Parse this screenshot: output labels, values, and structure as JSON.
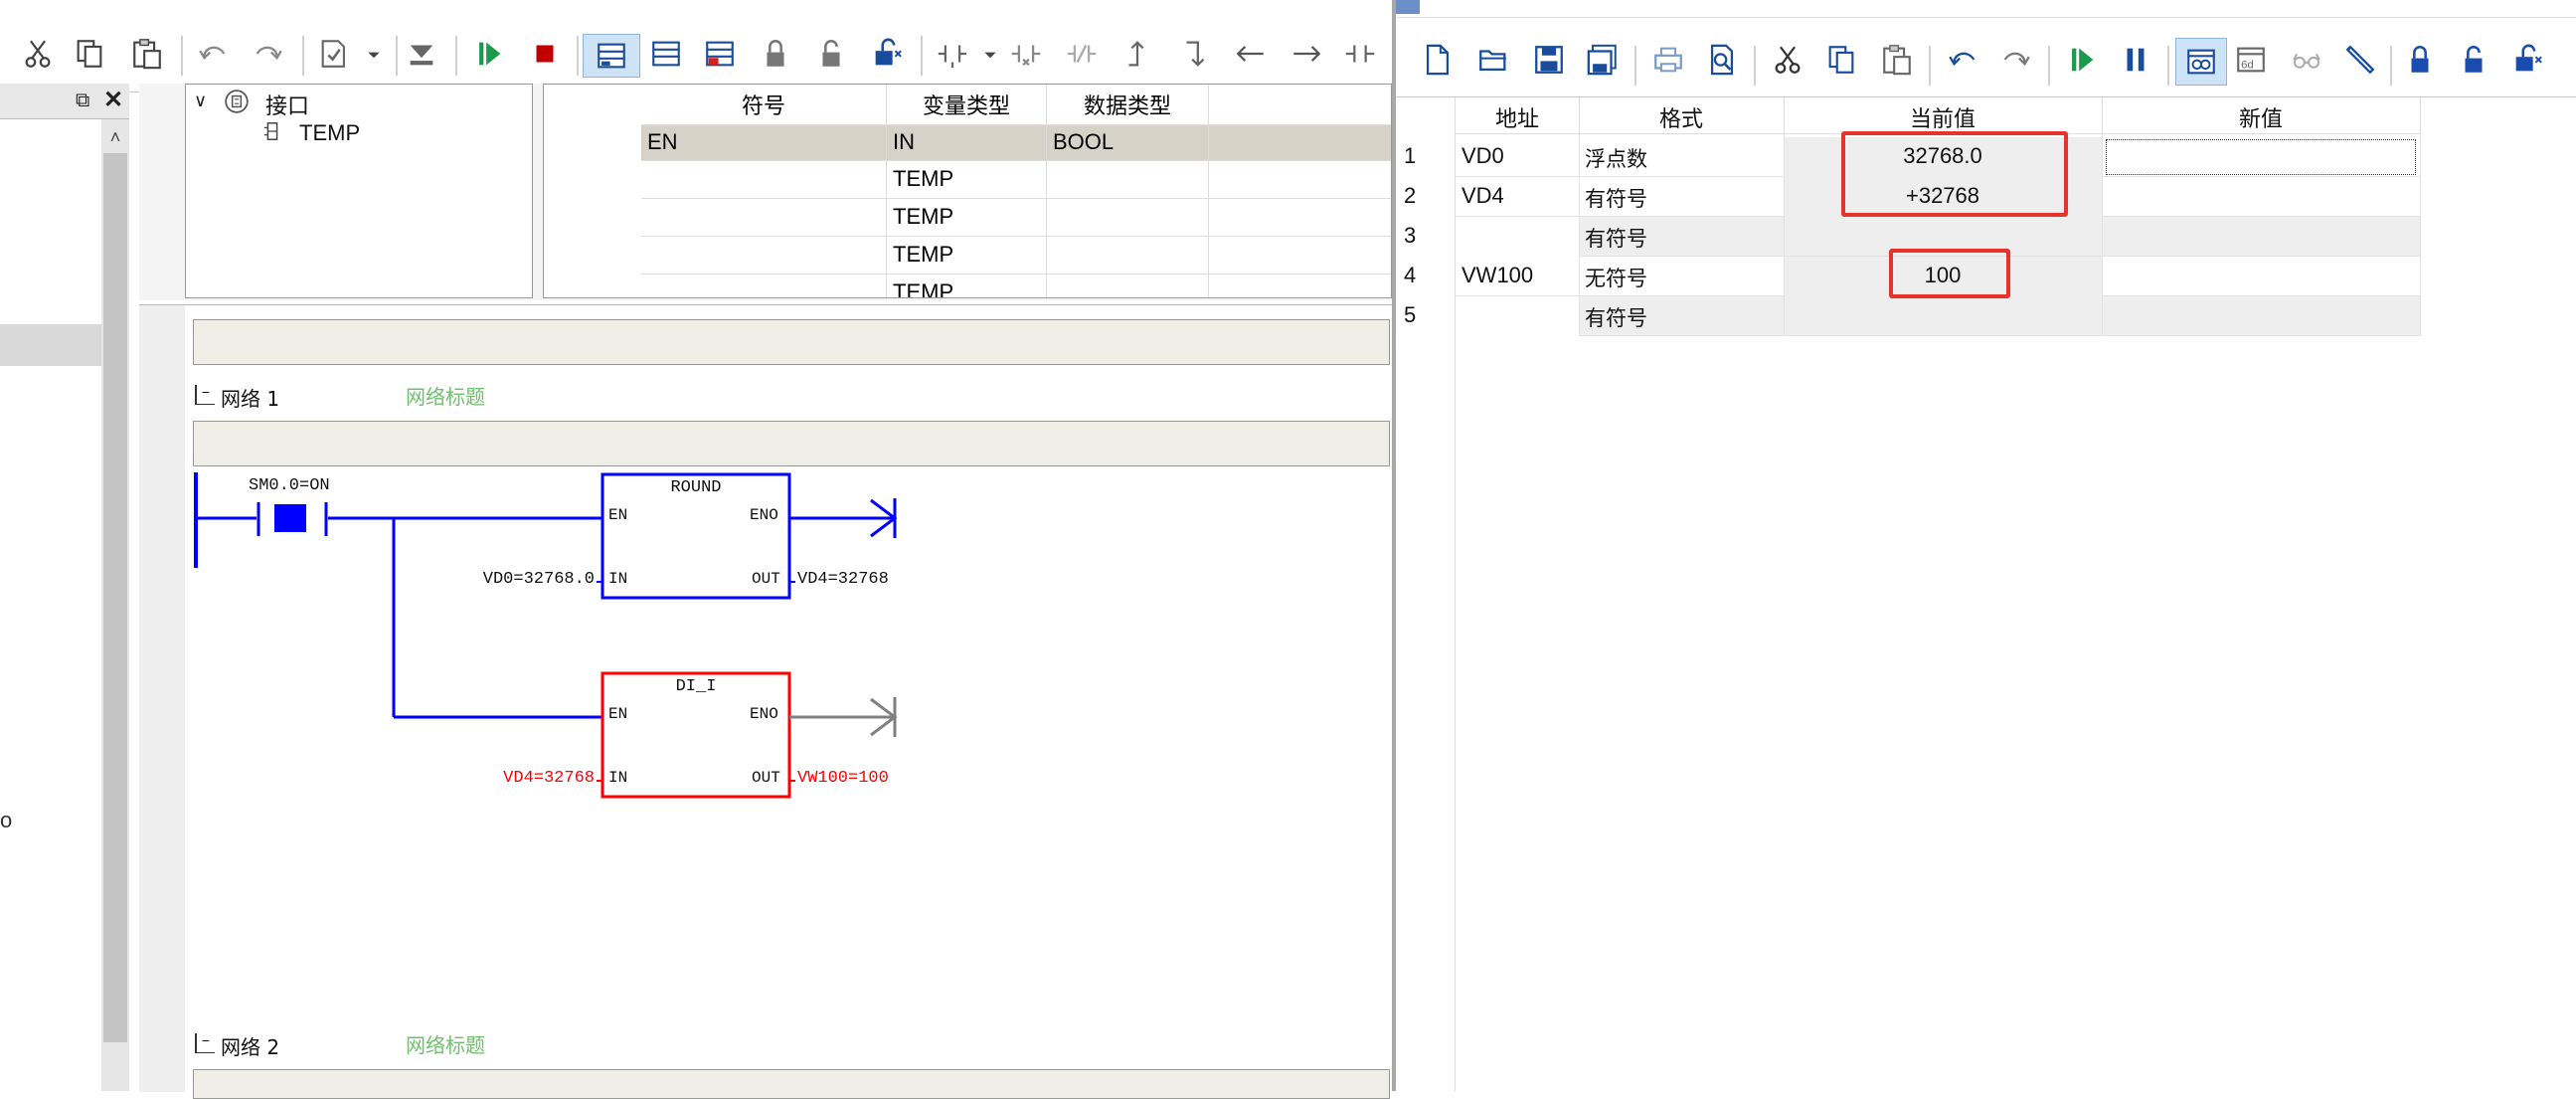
{
  "left_window": {
    "interface_tree": {
      "root": "接口",
      "child": "TEMP"
    },
    "var_table": {
      "headers": [
        "符号",
        "变量类型",
        "数据类型"
      ],
      "rows": [
        [
          "EN",
          "IN",
          "BOOL"
        ],
        [
          "",
          "TEMP",
          ""
        ],
        [
          "",
          "TEMP",
          ""
        ],
        [
          "",
          "TEMP",
          ""
        ],
        [
          "",
          "TEMP",
          ""
        ]
      ]
    },
    "network1": {
      "label": "网络 1",
      "title": "网络标题"
    },
    "network2": {
      "label": "网络 2",
      "title": "网络标题"
    },
    "ladder": {
      "contact_label": "SM0.0=ON",
      "round_block": {
        "name": "ROUND",
        "en": "EN",
        "eno": "ENO",
        "in": "IN",
        "out": "OUT",
        "in_value": "VD0=32768.0",
        "out_value": "VD4=32768"
      },
      "di_i_block": {
        "name": "DI_I",
        "en": "EN",
        "eno": "ENO",
        "in": "IN",
        "out": "OUT",
        "in_value": "VD4=32768",
        "out_value": "VW100=100"
      }
    },
    "side_text": "o"
  },
  "right_window": {
    "status_table": {
      "headers": [
        "地址",
        "格式",
        "当前值",
        "新值"
      ],
      "rows": [
        {
          "n": "1",
          "addr": "VD0",
          "fmt": "浮点数",
          "cur": "32768.0",
          "new": ""
        },
        {
          "n": "2",
          "addr": "VD4",
          "fmt": "有符号",
          "cur": "+32768",
          "new": ""
        },
        {
          "n": "3",
          "addr": "",
          "fmt": "有符号",
          "cur": "",
          "new": ""
        },
        {
          "n": "4",
          "addr": "VW100",
          "fmt": "无符号",
          "cur": "100",
          "new": ""
        },
        {
          "n": "5",
          "addr": "",
          "fmt": "有符号",
          "cur": "",
          "new": ""
        }
      ]
    }
  },
  "colors": {
    "active_blue": "#0000ff",
    "error_red": "#ff0000",
    "highlight_red": "#e8332a",
    "title_green": "#6fbf6f"
  }
}
